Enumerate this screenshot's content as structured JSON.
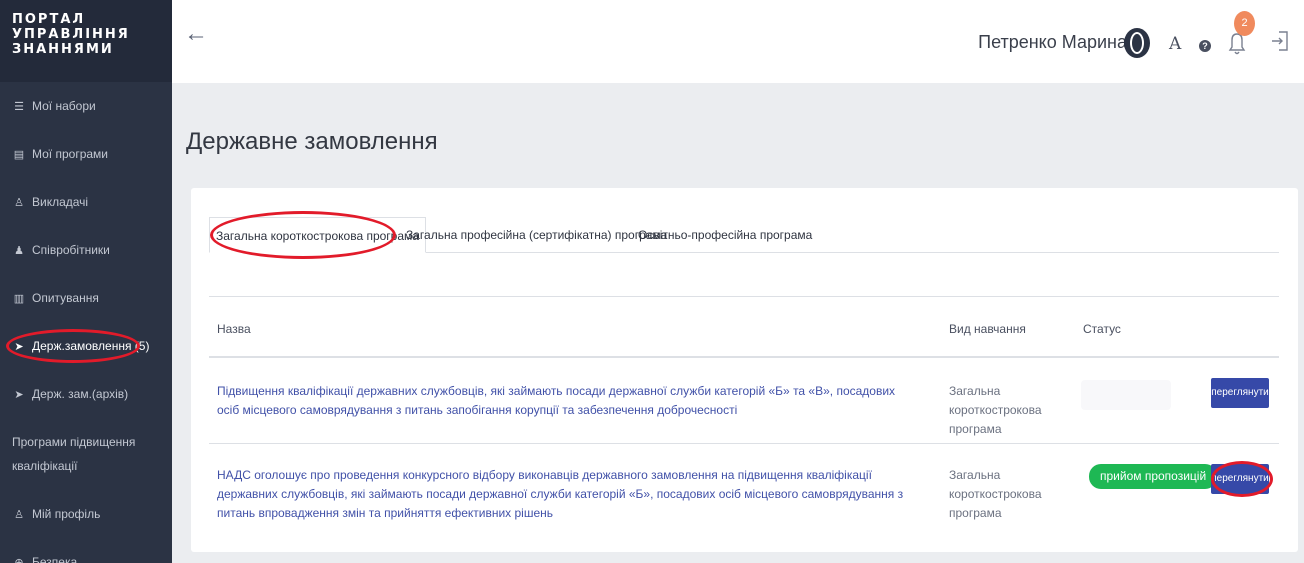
{
  "sidebar": {
    "logo_lines": [
      "ПОРТАЛ",
      "УПРАВЛІННЯ",
      "ЗНАННЯМИ"
    ],
    "items": [
      {
        "icon": "list-icon",
        "glyph": "☰",
        "label": "Мої набори"
      },
      {
        "icon": "book-icon",
        "glyph": "▤",
        "label": "Мої програми"
      },
      {
        "icon": "teacher-icon",
        "glyph": "♙",
        "label": "Викладачі"
      },
      {
        "icon": "users-icon",
        "glyph": "♟",
        "label": "Співробітники"
      },
      {
        "icon": "chart-icon",
        "glyph": "▥",
        "label": "Опитування"
      },
      {
        "icon": "gavel-icon",
        "glyph": "➤",
        "label": "Держ.замовлення (5)"
      },
      {
        "icon": "gavel-icon",
        "glyph": "➤",
        "label": "Держ. зам.(архів)"
      },
      {
        "icon": "",
        "glyph": "",
        "label": "Програми підвищення кваліфікації"
      },
      {
        "icon": "user-icon",
        "glyph": "♙",
        "label": "Мій профіль"
      },
      {
        "icon": "lock-icon",
        "glyph": "⊕",
        "label": "Безпека"
      }
    ]
  },
  "header": {
    "user_name": "Петренко Марина",
    "font_size_label": "A",
    "help_label": "?",
    "notification_count": "2"
  },
  "page": {
    "title": "Державне замовлення"
  },
  "tabs": [
    {
      "label": "Загальна короткострокова програма",
      "active": true
    },
    {
      "label": "Загальна професійна (сертифікатна) програма",
      "active": false
    },
    {
      "label": "Освітньо-професійна програма",
      "active": false
    }
  ],
  "table": {
    "columns": [
      "Назва",
      "Вид навчання",
      "Статус"
    ],
    "rows": [
      {
        "title": "Підвищення кваліфікації державних службовців, які займають посади державної служби категорій «Б» та «В», посадових осіб місцевого самоврядування з питань запобігання корупції та забезпечення доброчесності",
        "kind": "Загальна короткострокова програма",
        "status": "",
        "action": "переглянути"
      },
      {
        "title": "НАДС оголошує про проведення конкурсного відбору виконавців державного замовлення на підвищення кваліфікації державних службовців, які займають посади державної служби категорій «Б», посадових осіб місцевого самоврядування з питань впровадження змін та прийняття ефективних рішень",
        "kind": "Загальна короткострокова програма",
        "status": "прийом пропозицій",
        "action": "переглянути"
      }
    ]
  },
  "colors": {
    "sidebar_bg": "#2b3344",
    "accent_blue": "#3649a8",
    "status_green": "#1eb854",
    "annotation_red": "#e21b2a",
    "badge_orange": "#f08a5d"
  }
}
